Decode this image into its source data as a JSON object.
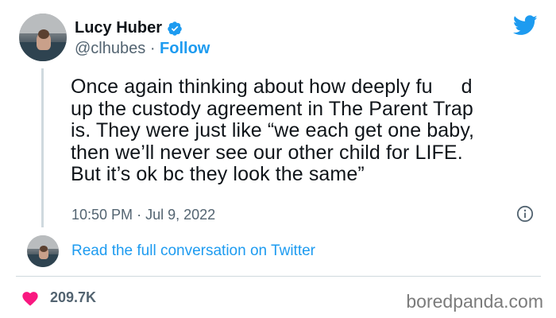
{
  "user": {
    "name": "Lucy Huber",
    "handle": "@clhubes",
    "separator": "·",
    "follow_label": "Follow"
  },
  "tweet": {
    "text_before_redaction": "Once again thinking about how deeply fu",
    "text_after_redaction": "d\nup the custody agreement in The Parent Trap\nis. They were just like “we each get one baby,\nthen we’ll never see our other child for LIFE.\nBut it’s ok bc they look the same”",
    "time": "10:50 PM",
    "date_separator": "·",
    "date": "Jul 9, 2022"
  },
  "read_link": "Read the full conversation on Twitter",
  "likes": "209.7K",
  "watermark": "boredpanda.com",
  "icons": {
    "verified": "verified-badge-icon",
    "twitter": "twitter-bird-icon",
    "info": "info-icon",
    "heart": "heart-icon"
  },
  "colors": {
    "accent": "#1d9bf0",
    "heart": "#f91880",
    "muted": "#536471",
    "text": "#0f1419"
  }
}
